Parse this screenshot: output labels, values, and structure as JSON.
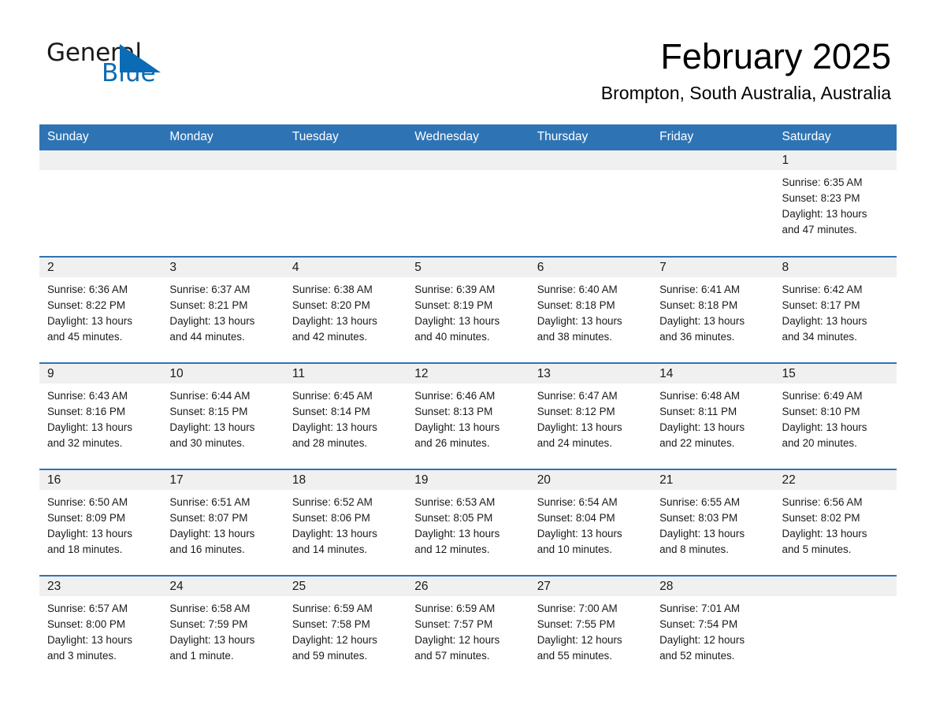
{
  "brand": {
    "word1": "General",
    "word2": "Blue",
    "accent_color": "#0b6cb5"
  },
  "header": {
    "title": "February 2025",
    "location": "Brompton, South Australia, Australia"
  },
  "theme": {
    "header_blue": "#2e74b5",
    "daynum_band": "#f0f0f0",
    "separator_blue": "#2e74b5"
  },
  "weekday_headers": [
    "Sunday",
    "Monday",
    "Tuesday",
    "Wednesday",
    "Thursday",
    "Friday",
    "Saturday"
  ],
  "weeks": [
    [
      {
        "day": "",
        "info": ""
      },
      {
        "day": "",
        "info": ""
      },
      {
        "day": "",
        "info": ""
      },
      {
        "day": "",
        "info": ""
      },
      {
        "day": "",
        "info": ""
      },
      {
        "day": "",
        "info": ""
      },
      {
        "day": "1",
        "info": "Sunrise: 6:35 AM\nSunset: 8:23 PM\nDaylight: 13 hours\nand 47 minutes."
      }
    ],
    [
      {
        "day": "2",
        "info": "Sunrise: 6:36 AM\nSunset: 8:22 PM\nDaylight: 13 hours\nand 45 minutes."
      },
      {
        "day": "3",
        "info": "Sunrise: 6:37 AM\nSunset: 8:21 PM\nDaylight: 13 hours\nand 44 minutes."
      },
      {
        "day": "4",
        "info": "Sunrise: 6:38 AM\nSunset: 8:20 PM\nDaylight: 13 hours\nand 42 minutes."
      },
      {
        "day": "5",
        "info": "Sunrise: 6:39 AM\nSunset: 8:19 PM\nDaylight: 13 hours\nand 40 minutes."
      },
      {
        "day": "6",
        "info": "Sunrise: 6:40 AM\nSunset: 8:18 PM\nDaylight: 13 hours\nand 38 minutes."
      },
      {
        "day": "7",
        "info": "Sunrise: 6:41 AM\nSunset: 8:18 PM\nDaylight: 13 hours\nand 36 minutes."
      },
      {
        "day": "8",
        "info": "Sunrise: 6:42 AM\nSunset: 8:17 PM\nDaylight: 13 hours\nand 34 minutes."
      }
    ],
    [
      {
        "day": "9",
        "info": "Sunrise: 6:43 AM\nSunset: 8:16 PM\nDaylight: 13 hours\nand 32 minutes."
      },
      {
        "day": "10",
        "info": "Sunrise: 6:44 AM\nSunset: 8:15 PM\nDaylight: 13 hours\nand 30 minutes."
      },
      {
        "day": "11",
        "info": "Sunrise: 6:45 AM\nSunset: 8:14 PM\nDaylight: 13 hours\nand 28 minutes."
      },
      {
        "day": "12",
        "info": "Sunrise: 6:46 AM\nSunset: 8:13 PM\nDaylight: 13 hours\nand 26 minutes."
      },
      {
        "day": "13",
        "info": "Sunrise: 6:47 AM\nSunset: 8:12 PM\nDaylight: 13 hours\nand 24 minutes."
      },
      {
        "day": "14",
        "info": "Sunrise: 6:48 AM\nSunset: 8:11 PM\nDaylight: 13 hours\nand 22 minutes."
      },
      {
        "day": "15",
        "info": "Sunrise: 6:49 AM\nSunset: 8:10 PM\nDaylight: 13 hours\nand 20 minutes."
      }
    ],
    [
      {
        "day": "16",
        "info": "Sunrise: 6:50 AM\nSunset: 8:09 PM\nDaylight: 13 hours\nand 18 minutes."
      },
      {
        "day": "17",
        "info": "Sunrise: 6:51 AM\nSunset: 8:07 PM\nDaylight: 13 hours\nand 16 minutes."
      },
      {
        "day": "18",
        "info": "Sunrise: 6:52 AM\nSunset: 8:06 PM\nDaylight: 13 hours\nand 14 minutes."
      },
      {
        "day": "19",
        "info": "Sunrise: 6:53 AM\nSunset: 8:05 PM\nDaylight: 13 hours\nand 12 minutes."
      },
      {
        "day": "20",
        "info": "Sunrise: 6:54 AM\nSunset: 8:04 PM\nDaylight: 13 hours\nand 10 minutes."
      },
      {
        "day": "21",
        "info": "Sunrise: 6:55 AM\nSunset: 8:03 PM\nDaylight: 13 hours\nand 8 minutes."
      },
      {
        "day": "22",
        "info": "Sunrise: 6:56 AM\nSunset: 8:02 PM\nDaylight: 13 hours\nand 5 minutes."
      }
    ],
    [
      {
        "day": "23",
        "info": "Sunrise: 6:57 AM\nSunset: 8:00 PM\nDaylight: 13 hours\nand 3 minutes."
      },
      {
        "day": "24",
        "info": "Sunrise: 6:58 AM\nSunset: 7:59 PM\nDaylight: 13 hours\nand 1 minute."
      },
      {
        "day": "25",
        "info": "Sunrise: 6:59 AM\nSunset: 7:58 PM\nDaylight: 12 hours\nand 59 minutes."
      },
      {
        "day": "26",
        "info": "Sunrise: 6:59 AM\nSunset: 7:57 PM\nDaylight: 12 hours\nand 57 minutes."
      },
      {
        "day": "27",
        "info": "Sunrise: 7:00 AM\nSunset: 7:55 PM\nDaylight: 12 hours\nand 55 minutes."
      },
      {
        "day": "28",
        "info": "Sunrise: 7:01 AM\nSunset: 7:54 PM\nDaylight: 12 hours\nand 52 minutes."
      },
      {
        "day": "",
        "info": ""
      }
    ]
  ]
}
